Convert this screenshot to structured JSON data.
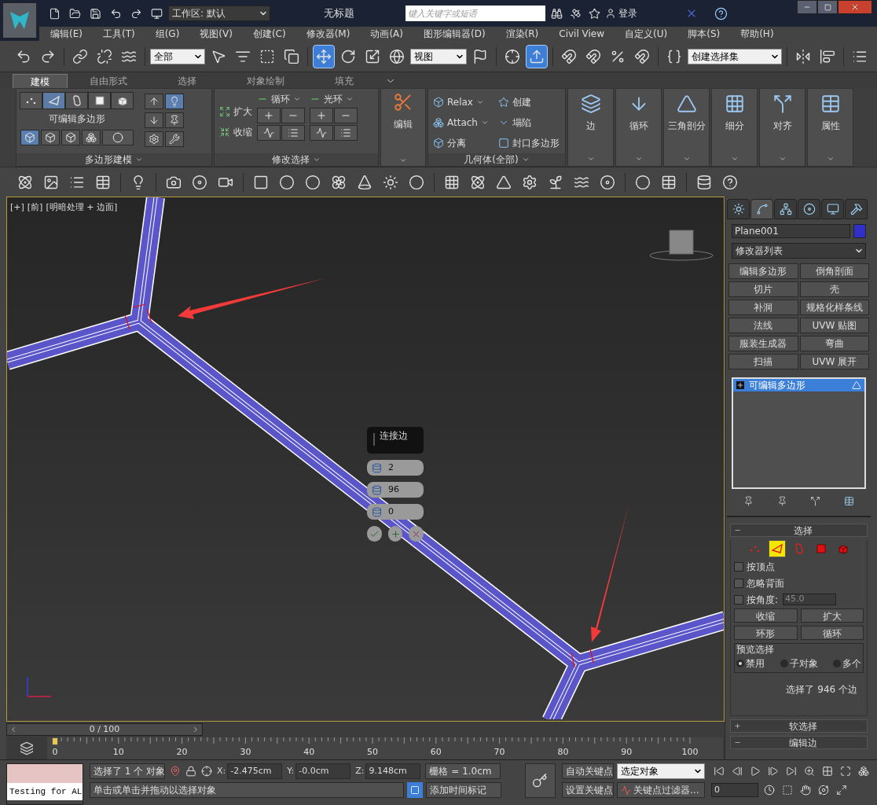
{
  "window": {
    "title": "无标题",
    "workspace": "工作区: 默认",
    "search": {
      "placeholder": "键入关键字或短语"
    },
    "sign_in": "登录"
  },
  "menu": [
    "编辑(E)",
    "工具(T)",
    "组(G)",
    "视图(V)",
    "创建(C)",
    "修改器(M)",
    "动画(A)",
    "图形编辑器(D)",
    "渲染(R)",
    "Civil View",
    "自定义(U)",
    "脚本(S)",
    "帮助(H)"
  ],
  "main_toolbar": {
    "selection_filter": "全部",
    "reference_coord": "视图",
    "named_selection": "创建选择集",
    "tools": [
      {
        "selected": false
      },
      {
        "selected": false
      },
      {
        "selected": false
      },
      {
        "selected": false
      },
      {
        "selected": false
      },
      {
        "selected": false
      },
      {
        "selected": false
      },
      {
        "selected": false
      },
      {
        "selected": false
      },
      {
        "selected": true
      },
      {
        "selected": false
      },
      {
        "selected": false
      },
      {
        "selected": false
      },
      {
        "selected": false
      },
      {
        "selected": false
      },
      {
        "selected": true
      },
      {
        "selected": false
      },
      {
        "selected": false
      },
      {
        "selected": false
      },
      {
        "selected": false
      },
      {
        "selected": false
      },
      {
        "selected": false
      },
      {
        "selected": false
      },
      {
        "selected": false
      }
    ]
  },
  "ribbon": {
    "tabs": [
      {
        "label": "建模",
        "selected": true
      },
      {
        "label": "自由形式",
        "selected": false
      },
      {
        "label": "选择",
        "selected": false
      },
      {
        "label": "对象绘制",
        "selected": false
      },
      {
        "label": "填充",
        "selected": false
      }
    ],
    "polygon_modeling": {
      "title": "多边形建模",
      "levels": [
        {
          "selected": false
        },
        {
          "selected": true
        },
        {
          "selected": false
        },
        {
          "selected": false
        },
        {
          "selected": false
        }
      ],
      "object_type": "可编辑多边形",
      "modes": [
        {
          "selected": true
        },
        {
          "selected": false
        },
        {
          "selected": false
        },
        {
          "selected": false
        },
        {
          "selected": false
        }
      ],
      "side_tools": [
        {
          "selected": false
        },
        {
          "selected": true
        },
        {
          "selected": false
        },
        {
          "selected": false
        },
        {
          "selected": false
        },
        {
          "selected": false
        }
      ]
    },
    "modify_selection": {
      "title": "修改选择",
      "grow": "扩大",
      "shrink": "收缩",
      "loop": "循环",
      "ring": "光环"
    },
    "edit": {
      "label": "编辑"
    },
    "geometry": {
      "title": "几何体(全部)",
      "items": [
        {
          "label": "Relax",
          "kind": "dropdown"
        },
        {
          "label": "Attach",
          "kind": "dropdown"
        },
        {
          "label": "分离",
          "kind": "button"
        },
        {
          "label": "创建",
          "kind": "button"
        },
        {
          "label": "塌陷",
          "kind": "button"
        },
        {
          "label": "封口多边形",
          "kind": "button"
        }
      ]
    },
    "panels": [
      "边",
      "循环",
      "三角剖分",
      "细分",
      "对齐",
      "属性"
    ]
  },
  "viewport": {
    "labels": [
      "[+]",
      "[前]",
      "[明暗处理 + 边面]"
    ],
    "caddy": {
      "title": "连接边",
      "fields": [
        "2",
        "96",
        "0"
      ]
    }
  },
  "command_panel": {
    "tabs": [
      {
        "selected": false
      },
      {
        "selected": true
      },
      {
        "selected": false
      },
      {
        "selected": false
      },
      {
        "selected": false
      },
      {
        "selected": false
      }
    ],
    "object_name": "Plane001",
    "modifier_list": "修改器列表",
    "modifier_buttons": [
      "编辑多边形",
      "倒角剖面",
      "切片",
      "壳",
      "补洞",
      "规格化样条线",
      "法线",
      "UVW 贴图",
      "服装生成器",
      "弯曲",
      "扫描",
      "UVW 展开"
    ],
    "stack": [
      {
        "label": "可编辑多边形",
        "selected": true
      }
    ],
    "selection": {
      "title": "选择",
      "expanded": true,
      "levels": [
        {
          "selected": false
        },
        {
          "selected": true
        },
        {
          "selected": false
        },
        {
          "selected": false
        },
        {
          "selected": false
        }
      ],
      "checks": [
        {
          "label": "按顶点",
          "checked": false
        },
        {
          "label": "忽略背面",
          "checked": false
        },
        {
          "label": "按角度:",
          "checked": false,
          "value": "45.0",
          "disabled": true
        }
      ],
      "buttons": [
        "收缩",
        "扩大",
        "环形",
        "循环"
      ],
      "preview": {
        "title": "预览选择",
        "options": [
          {
            "label": "禁用",
            "selected": true
          },
          {
            "label": "子对象",
            "selected": false
          },
          {
            "label": "多个",
            "selected": false
          }
        ]
      },
      "status": "选择了 946 个边"
    },
    "rollouts": [
      {
        "title": "软选择",
        "expanded": false
      },
      {
        "title": "编辑边",
        "expanded": true
      }
    ]
  },
  "timeline": {
    "position": "0 / 100",
    "level": 0,
    "ruler": [
      "0",
      "10",
      "20",
      "30",
      "40",
      "50",
      "60",
      "70",
      "80",
      "90",
      "100"
    ]
  },
  "status_bar": {
    "script_listener": "Testing for AL",
    "selection": "选择了 1 个 对象",
    "coords": [
      {
        "axis": "X:",
        "value": "-2.475cm"
      },
      {
        "axis": "Y:",
        "value": "-0.0cm"
      },
      {
        "axis": "Z:",
        "value": "9.148cm"
      }
    ],
    "grid": "栅格 = 1.0cm",
    "prompt": "单击或单击并拖动以选择对象",
    "add_time_tag": "添加时间标记",
    "auto_key": "自动关键点",
    "set_key": "设置关键点",
    "key_mode": "选定对象",
    "key_filters": "关键点过滤器...",
    "frame": "0"
  }
}
